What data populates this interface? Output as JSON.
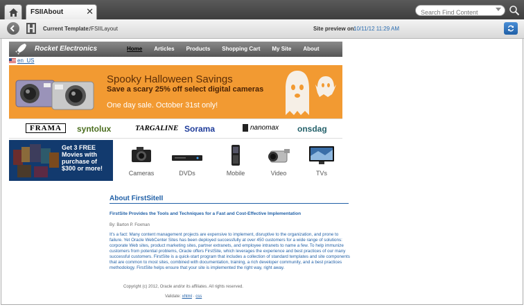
{
  "tabstrip": {
    "tab_label": "FSIIAbout",
    "close_glyph": "✕",
    "search_placeholder": "Search Find Content"
  },
  "toolbar": {
    "template_label": "Current Template:",
    "template_value": "/FSIILayout",
    "preview_label": "Site preview on:",
    "preview_value": "10/11/12 11:29 AM"
  },
  "site": {
    "name": "Rocket Electronics",
    "nav": [
      "Home",
      "Articles",
      "Products",
      "Shopping Cart",
      "My Site",
      "About"
    ],
    "active_nav": "Home",
    "locale": "en_US"
  },
  "banner": {
    "title": "Spooky Halloween Savings",
    "subtitle": "Save a scary 25% off select digital cameras",
    "date": "One day sale. October 31st only!"
  },
  "brands": [
    "FRAMA",
    "syntolux",
    "TARGALINE",
    "Sorama",
    "nanomax",
    "onsdag"
  ],
  "promo": {
    "line1": "Get 3 FREE",
    "line2": "Movies with",
    "line3": "purchase of",
    "line4": "$300 or more!"
  },
  "categories": [
    "Cameras",
    "DVDs",
    "Mobile",
    "Video",
    "TVs"
  ],
  "article": {
    "title": "About FirstSiteII",
    "subtitle": "FirstSite Provides the Tools and Techniques for a Fast and Cost-Effective Implementation",
    "byline": "By:  Barton P. Foxman",
    "body": "It's a fact: Many content management projects are expensive to implement, disruptive to the organization, and prone to failure. Yet Oracle WebCenter Sites has been deployed successfully at over 450 customers for a wide range of solutions: corporate Web sites, product marketing sites, partner extranets, and employee intranets to name a few. To help immunize customers from potential problems, Oracle offers FirstSite, which leverages the experience and best practices of our many successful customers. FirstSite is a quick-start program that includes a collection of standard templates and site components that are common to most sites, combined with documentation, training, a rich developer community, and a best practices methodology. FirstSite helps ensure that your site is implemented the right way, right away.",
    "copyright": "Copyright (c) 2012, Oracle and/or its affiliates. All rights reserved.",
    "validate_label": "Validate:",
    "validate_xhtml": "xhtml",
    "validate_css": "css"
  },
  "colors": {
    "banner": "#f29a32",
    "link": "#1f5fa6",
    "promo": "#123a6e"
  }
}
